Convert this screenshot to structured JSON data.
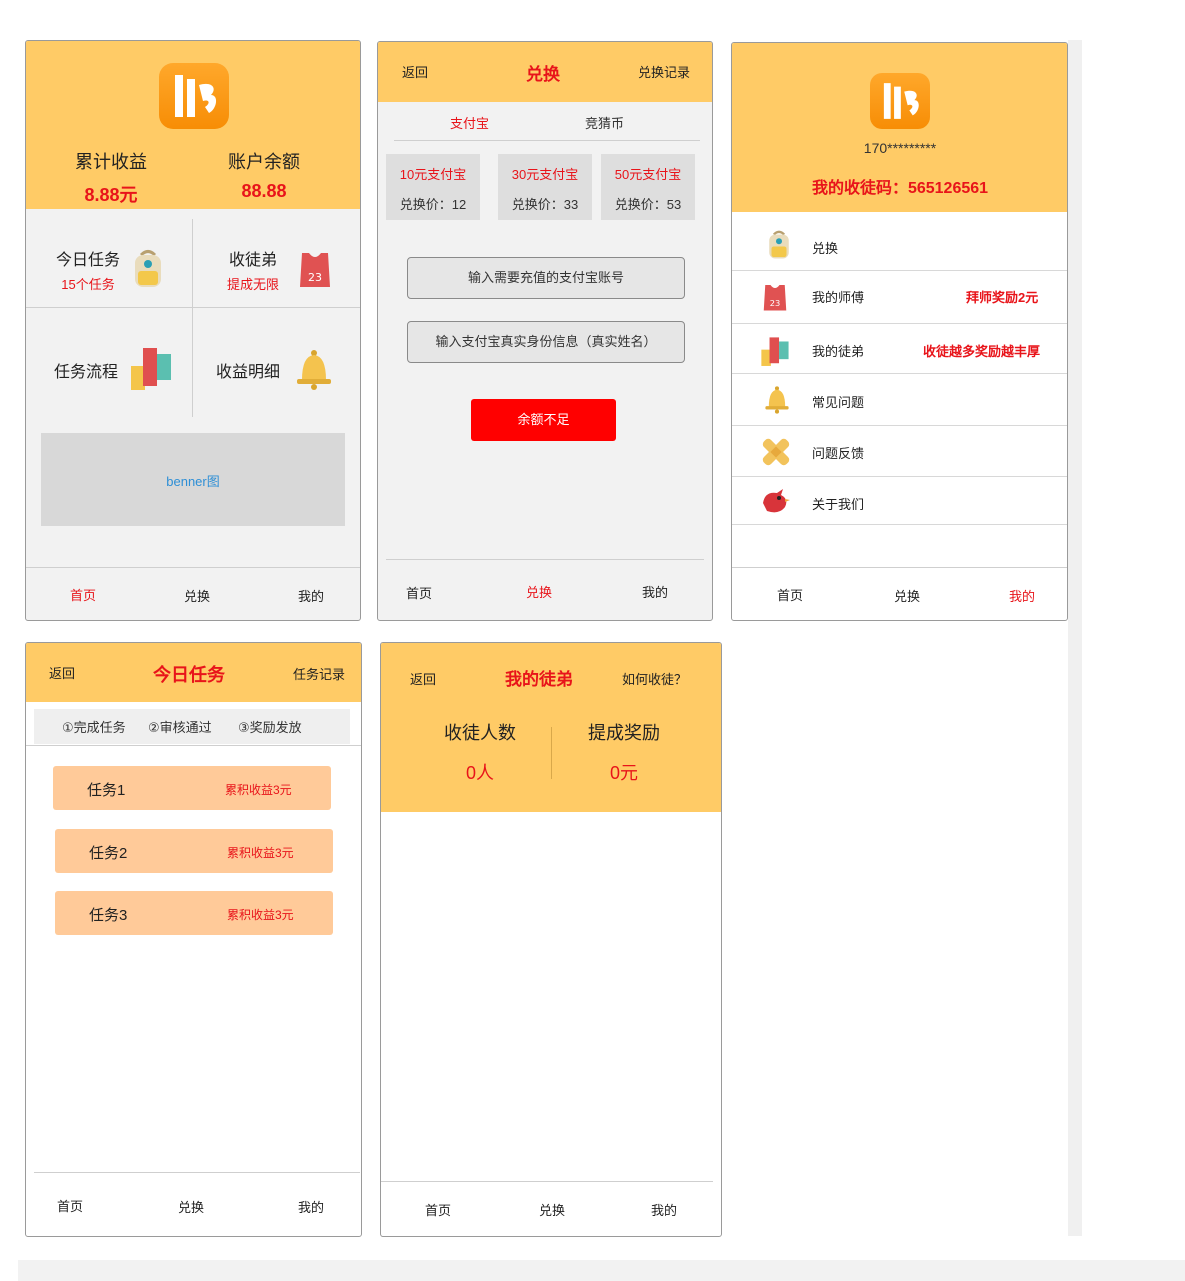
{
  "colors": {
    "header": "#ffcb66",
    "accent_red": "#e8141a",
    "button_red": "#ff0000",
    "task_bg": "#ffca99",
    "logo": "#f89205"
  },
  "home": {
    "stats": [
      {
        "label": "累计收益",
        "value": "8.88元"
      },
      {
        "label": "账户余额",
        "value": "88.88"
      }
    ],
    "cells": [
      {
        "title": "今日任务",
        "sub": "15个任务",
        "icon": "backpack-icon"
      },
      {
        "title": "收徒弟",
        "sub": "提成无限",
        "icon": "jersey-icon"
      },
      {
        "title": "任务流程",
        "sub": "",
        "icon": "blocks-icon"
      },
      {
        "title": "收益明细",
        "sub": "",
        "icon": "bell-icon"
      }
    ],
    "banner": "benner图",
    "nav": [
      "首页",
      "兑换",
      "我的"
    ]
  },
  "exchange": {
    "back": "返回",
    "title": "兑换",
    "record": "兑换记录",
    "tabs": [
      "支付宝",
      "竞猜币"
    ],
    "cards": [
      {
        "title": "10元支付宝",
        "price": "兑换价：12"
      },
      {
        "title": "30元支付宝",
        "price": "兑换价：33"
      },
      {
        "title": "50元支付宝",
        "price": "兑换价：53"
      }
    ],
    "account_placeholder": "输入需要充值的支付宝账号",
    "name_placeholder": "输入支付宝真实身份信息（真实姓名）",
    "submit": "余额不足",
    "nav": [
      "首页",
      "兑换",
      "我的"
    ]
  },
  "mine": {
    "phone": "170*********",
    "invite_code": "我的收徒码：565126561",
    "menu": [
      {
        "label": "兑换",
        "extra": "",
        "icon": "backpack-icon"
      },
      {
        "label": "我的师傅",
        "extra": "拜师奖励2元",
        "icon": "jersey-icon"
      },
      {
        "label": "我的徒弟",
        "extra": "收徒越多奖励越丰厚",
        "icon": "blocks-icon"
      },
      {
        "label": "常见问题",
        "extra": "",
        "icon": "bell-icon"
      },
      {
        "label": "问题反馈",
        "extra": "",
        "icon": "bandage-icon"
      },
      {
        "label": "关于我们",
        "extra": "",
        "icon": "bird-icon"
      }
    ],
    "nav": [
      "首页",
      "兑换",
      "我的"
    ]
  },
  "tasks": {
    "back": "返回",
    "title": "今日任务",
    "record": "任务记录",
    "steps": [
      "①完成任务",
      "②审核通过",
      "③奖励发放"
    ],
    "items": [
      {
        "name": "任务1",
        "reward": "累积收益3元"
      },
      {
        "name": "任务2",
        "reward": "累积收益3元"
      },
      {
        "name": "任务3",
        "reward": "累积收益3元"
      }
    ],
    "nav": [
      "首页",
      "兑换",
      "我的"
    ]
  },
  "apprentice": {
    "back": "返回",
    "title": "我的徒弟",
    "help": "如何收徒？",
    "stats": [
      {
        "label": "收徒人数",
        "value": "0人"
      },
      {
        "label": "提成奖励",
        "value": "0元"
      }
    ],
    "nav": [
      "首页",
      "兑换",
      "我的"
    ]
  }
}
